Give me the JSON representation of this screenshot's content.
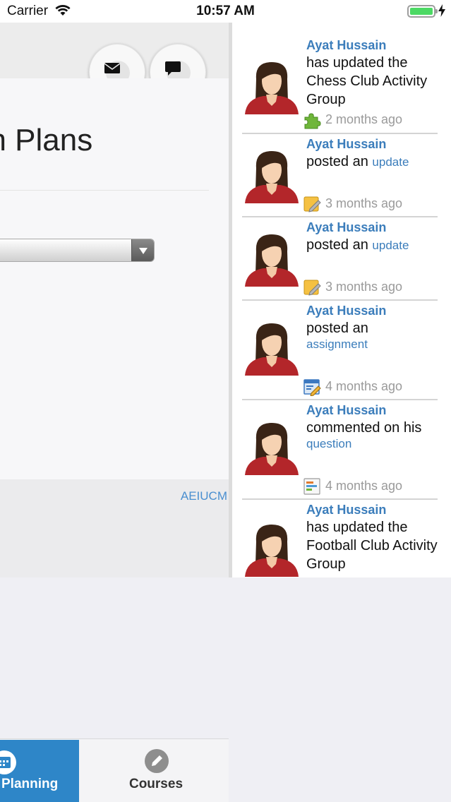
{
  "status_bar": {
    "carrier": "Carrier",
    "time": "10:57 AM",
    "battery_color": "#4cd964"
  },
  "main": {
    "page_title": "on Plans",
    "select_value": "",
    "footer_link": "AEIUCM"
  },
  "header_icons": [
    "mail-icon",
    "chat-bubble-icon"
  ],
  "feed": [
    {
      "name": "Ayat Hussain",
      "text": "has updated the Chess Club Activity Group",
      "link": "",
      "time": "2 months ago",
      "icon": "puzzle-icon"
    },
    {
      "name": "Ayat Hussain",
      "text": "posted an",
      "link": "update",
      "time": "3 months ago",
      "icon": "note-pencil-icon"
    },
    {
      "name": "Ayat Hussain",
      "text": "posted an",
      "link": "update",
      "time": "3 months ago",
      "icon": "note-pencil-icon"
    },
    {
      "name": "Ayat Hussain",
      "text": "posted an",
      "link": "assignment",
      "time": "4 months ago",
      "icon": "assignment-icon"
    },
    {
      "name": "Ayat Hussain",
      "text": "commented on his",
      "link": "question",
      "time": "4 months ago",
      "icon": "question-icon"
    },
    {
      "name": "Ayat Hussain",
      "text": "has updated the Football Club Activity Group",
      "link": "",
      "time": "",
      "icon": ""
    }
  ],
  "tabs": [
    {
      "label": "Planning",
      "icon": "calendar-icon",
      "active": true,
      "color": "#2e86c8"
    },
    {
      "label": "Courses",
      "icon": "pencil-icon",
      "active": false
    }
  ],
  "colors": {
    "link": "#3b7dbb",
    "accent": "#2e86c8",
    "footer_link": "#4a8fd0"
  }
}
